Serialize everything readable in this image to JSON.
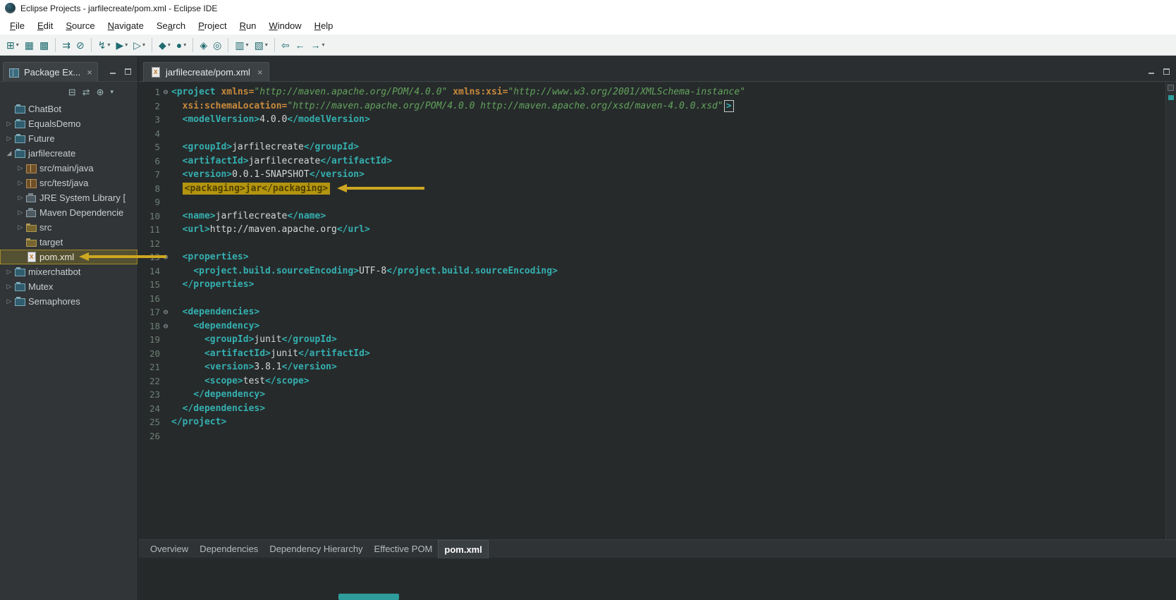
{
  "window": {
    "title": "Eclipse Projects - jarfilecreate/pom.xml - Eclipse IDE"
  },
  "menu": {
    "items": [
      {
        "label": "File",
        "mnemonic": "F"
      },
      {
        "label": "Edit",
        "mnemonic": "E"
      },
      {
        "label": "Source",
        "mnemonic": "S"
      },
      {
        "label": "Navigate",
        "mnemonic": "N"
      },
      {
        "label": "Search",
        "mnemonic": "a"
      },
      {
        "label": "Project",
        "mnemonic": "P"
      },
      {
        "label": "Run",
        "mnemonic": "R"
      },
      {
        "label": "Window",
        "mnemonic": "W"
      },
      {
        "label": "Help",
        "mnemonic": "H"
      }
    ]
  },
  "toolbar": {
    "buttons": [
      {
        "name": "new-wizard",
        "glyph": "⊞",
        "dropdown": true
      },
      {
        "name": "save",
        "glyph": "▦"
      },
      {
        "name": "save-all",
        "glyph": "▩"
      },
      {
        "sep": true
      },
      {
        "name": "build-all",
        "glyph": "⇉"
      },
      {
        "name": "skip-breakpoints",
        "glyph": "⊘"
      },
      {
        "sep": true
      },
      {
        "name": "debug",
        "glyph": "↯",
        "dropdown": true
      },
      {
        "name": "run",
        "glyph": "▶",
        "dropdown": true
      },
      {
        "name": "run-external-tools",
        "glyph": "▷",
        "dropdown": true
      },
      {
        "sep": true
      },
      {
        "name": "new-java-project",
        "glyph": "◆",
        "dropdown": true
      },
      {
        "name": "new-java-class",
        "glyph": "●",
        "dropdown": true
      },
      {
        "sep": true
      },
      {
        "name": "open-type",
        "glyph": "◈"
      },
      {
        "name": "search",
        "glyph": "◎"
      },
      {
        "sep": true
      },
      {
        "name": "mark-occurrences",
        "glyph": "▥",
        "dropdown": true
      },
      {
        "name": "annotations",
        "glyph": "▧",
        "dropdown": true
      },
      {
        "sep": true
      },
      {
        "name": "previous-edit",
        "glyph": "⇦"
      },
      {
        "name": "back",
        "glyph": "←"
      },
      {
        "name": "forward",
        "glyph": "→",
        "dropdown": true
      }
    ]
  },
  "package_explorer": {
    "tab_label": "Package Ex...",
    "toolbar": [
      {
        "name": "collapse-all",
        "glyph": "⊟"
      },
      {
        "name": "link-with-editor",
        "glyph": "⇄"
      },
      {
        "name": "focus-on-active-task",
        "glyph": "⊕"
      },
      {
        "name": "view-menu",
        "glyph": "▾"
      }
    ],
    "items": [
      {
        "label": "ChatBot",
        "level": 0,
        "icon": "project",
        "expander": "none"
      },
      {
        "label": "EqualsDemo",
        "level": 0,
        "icon": "project",
        "expander": "collapsed"
      },
      {
        "label": "Future",
        "level": 0,
        "icon": "project",
        "expander": "collapsed"
      },
      {
        "label": "jarfilecreate",
        "level": 0,
        "icon": "project",
        "expander": "expanded"
      },
      {
        "label": "src/main/java",
        "level": 1,
        "icon": "srcpkg",
        "expander": "collapsed"
      },
      {
        "label": "src/test/java",
        "level": 1,
        "icon": "srcpkg",
        "expander": "collapsed"
      },
      {
        "label": "JRE System Library [",
        "level": 1,
        "icon": "library",
        "expander": "collapsed"
      },
      {
        "label": "Maven Dependencie",
        "level": 1,
        "icon": "library",
        "expander": "collapsed"
      },
      {
        "label": "src",
        "level": 1,
        "icon": "folder",
        "expander": "collapsed"
      },
      {
        "label": "target",
        "level": 1,
        "icon": "folder",
        "expander": "none"
      },
      {
        "label": "pom.xml",
        "level": 1,
        "icon": "xmlfile",
        "expander": "none",
        "selected": true
      },
      {
        "label": "mixerchatbot",
        "level": 0,
        "icon": "project",
        "expander": "collapsed"
      },
      {
        "label": "Mutex",
        "level": 0,
        "icon": "project",
        "expander": "collapsed"
      },
      {
        "label": "Semaphores",
        "level": 0,
        "icon": "project",
        "expander": "collapsed"
      }
    ]
  },
  "editor": {
    "tab_label": "jarfilecreate/pom.xml",
    "bottom_tabs": [
      "Overview",
      "Dependencies",
      "Dependency Hierarchy",
      "Effective POM",
      "pom.xml"
    ],
    "selected_bottom_tab": "pom.xml",
    "lines": [
      {
        "n": 1,
        "fold": true,
        "segs": [
          [
            "tg",
            "<project"
          ],
          [
            "tx",
            " "
          ],
          [
            "at",
            "xmlns="
          ],
          [
            "av",
            "\"http://maven.apache.org/POM/4.0.0\""
          ],
          [
            "tx",
            " "
          ],
          [
            "at",
            "xmlns:xsi="
          ],
          [
            "av",
            "\"http://www.w3.org/2001/XMLSchema-instance\""
          ]
        ]
      },
      {
        "n": 2,
        "segs": [
          [
            "tx",
            "  "
          ],
          [
            "at",
            "xsi:schemaLocation="
          ],
          [
            "av",
            "\"http://maven.apache.org/POM/4.0.0 http://maven.apache.org/xsd/maven-4.0.0.xsd\""
          ],
          [
            "tg box",
            ">"
          ]
        ]
      },
      {
        "n": 3,
        "segs": [
          [
            "tx",
            "  "
          ],
          [
            "tg",
            "<modelVersion>"
          ],
          [
            "tx",
            "4.0.0"
          ],
          [
            "tg",
            "</modelVersion>"
          ]
        ]
      },
      {
        "n": 4,
        "segs": []
      },
      {
        "n": 5,
        "segs": [
          [
            "tx",
            "  "
          ],
          [
            "tg",
            "<groupId>"
          ],
          [
            "tx",
            "jarfilecreate"
          ],
          [
            "tg",
            "</groupId>"
          ]
        ]
      },
      {
        "n": 6,
        "segs": [
          [
            "tx",
            "  "
          ],
          [
            "tg",
            "<artifactId>"
          ],
          [
            "tx",
            "jarfilecreate"
          ],
          [
            "tg",
            "</artifactId>"
          ]
        ]
      },
      {
        "n": 7,
        "segs": [
          [
            "tx",
            "  "
          ],
          [
            "tg",
            "<version>"
          ],
          [
            "tx",
            "0.0.1-SNAPSHOT"
          ],
          [
            "tg",
            "</version>"
          ]
        ]
      },
      {
        "n": 8,
        "arrow": true,
        "segs": [
          [
            "tx",
            "  "
          ],
          [
            "hl",
            "<packaging>jar</packaging>"
          ]
        ]
      },
      {
        "n": 9,
        "segs": []
      },
      {
        "n": 10,
        "segs": [
          [
            "tx",
            "  "
          ],
          [
            "tg",
            "<name>"
          ],
          [
            "tx",
            "jarfilecreate"
          ],
          [
            "tg",
            "</name>"
          ]
        ]
      },
      {
        "n": 11,
        "segs": [
          [
            "tx",
            "  "
          ],
          [
            "tg",
            "<url>"
          ],
          [
            "tx",
            "http://maven.apache.org"
          ],
          [
            "tg",
            "</url>"
          ]
        ]
      },
      {
        "n": 12,
        "segs": []
      },
      {
        "n": 13,
        "fold": true,
        "segs": [
          [
            "tx",
            "  "
          ],
          [
            "tg",
            "<properties>"
          ]
        ]
      },
      {
        "n": 14,
        "segs": [
          [
            "tx",
            "    "
          ],
          [
            "tg",
            "<project.build.sourceEncoding>"
          ],
          [
            "tx",
            "UTF-8"
          ],
          [
            "tg",
            "</project.build.sourceEncoding>"
          ]
        ]
      },
      {
        "n": 15,
        "segs": [
          [
            "tx",
            "  "
          ],
          [
            "tg",
            "</properties>"
          ]
        ]
      },
      {
        "n": 16,
        "segs": []
      },
      {
        "n": 17,
        "fold": true,
        "segs": [
          [
            "tx",
            "  "
          ],
          [
            "tg",
            "<dependencies>"
          ]
        ]
      },
      {
        "n": 18,
        "fold": true,
        "segs": [
          [
            "tx",
            "    "
          ],
          [
            "tg",
            "<dependency>"
          ]
        ]
      },
      {
        "n": 19,
        "segs": [
          [
            "tx",
            "      "
          ],
          [
            "tg",
            "<groupId>"
          ],
          [
            "tx",
            "junit"
          ],
          [
            "tg",
            "</groupId>"
          ]
        ]
      },
      {
        "n": 20,
        "segs": [
          [
            "tx",
            "      "
          ],
          [
            "tg",
            "<artifactId>"
          ],
          [
            "tx",
            "junit"
          ],
          [
            "tg",
            "</artifactId>"
          ]
        ]
      },
      {
        "n": 21,
        "segs": [
          [
            "tx",
            "      "
          ],
          [
            "tg",
            "<version>"
          ],
          [
            "tx",
            "3.8.1"
          ],
          [
            "tg",
            "</version>"
          ]
        ]
      },
      {
        "n": 22,
        "segs": [
          [
            "tx",
            "      "
          ],
          [
            "tg",
            "<scope>"
          ],
          [
            "tx",
            "test"
          ],
          [
            "tg",
            "</scope>"
          ]
        ]
      },
      {
        "n": 23,
        "segs": [
          [
            "tx",
            "    "
          ],
          [
            "tg",
            "</dependency>"
          ]
        ]
      },
      {
        "n": 24,
        "segs": [
          [
            "tx",
            "  "
          ],
          [
            "tg",
            "</dependencies>"
          ]
        ]
      },
      {
        "n": 25,
        "segs": [
          [
            "tg",
            "</project>"
          ]
        ]
      },
      {
        "n": 26,
        "segs": []
      }
    ]
  },
  "colors": {
    "tag": "#35AFAF",
    "attribute": "#C98A3C",
    "attribute_value": "#63A35C",
    "text_content": "#D6D6D6",
    "highlight_background": "#B3950F",
    "annotation_arrow": "#CDA721",
    "editor_background": "#262A2B"
  }
}
